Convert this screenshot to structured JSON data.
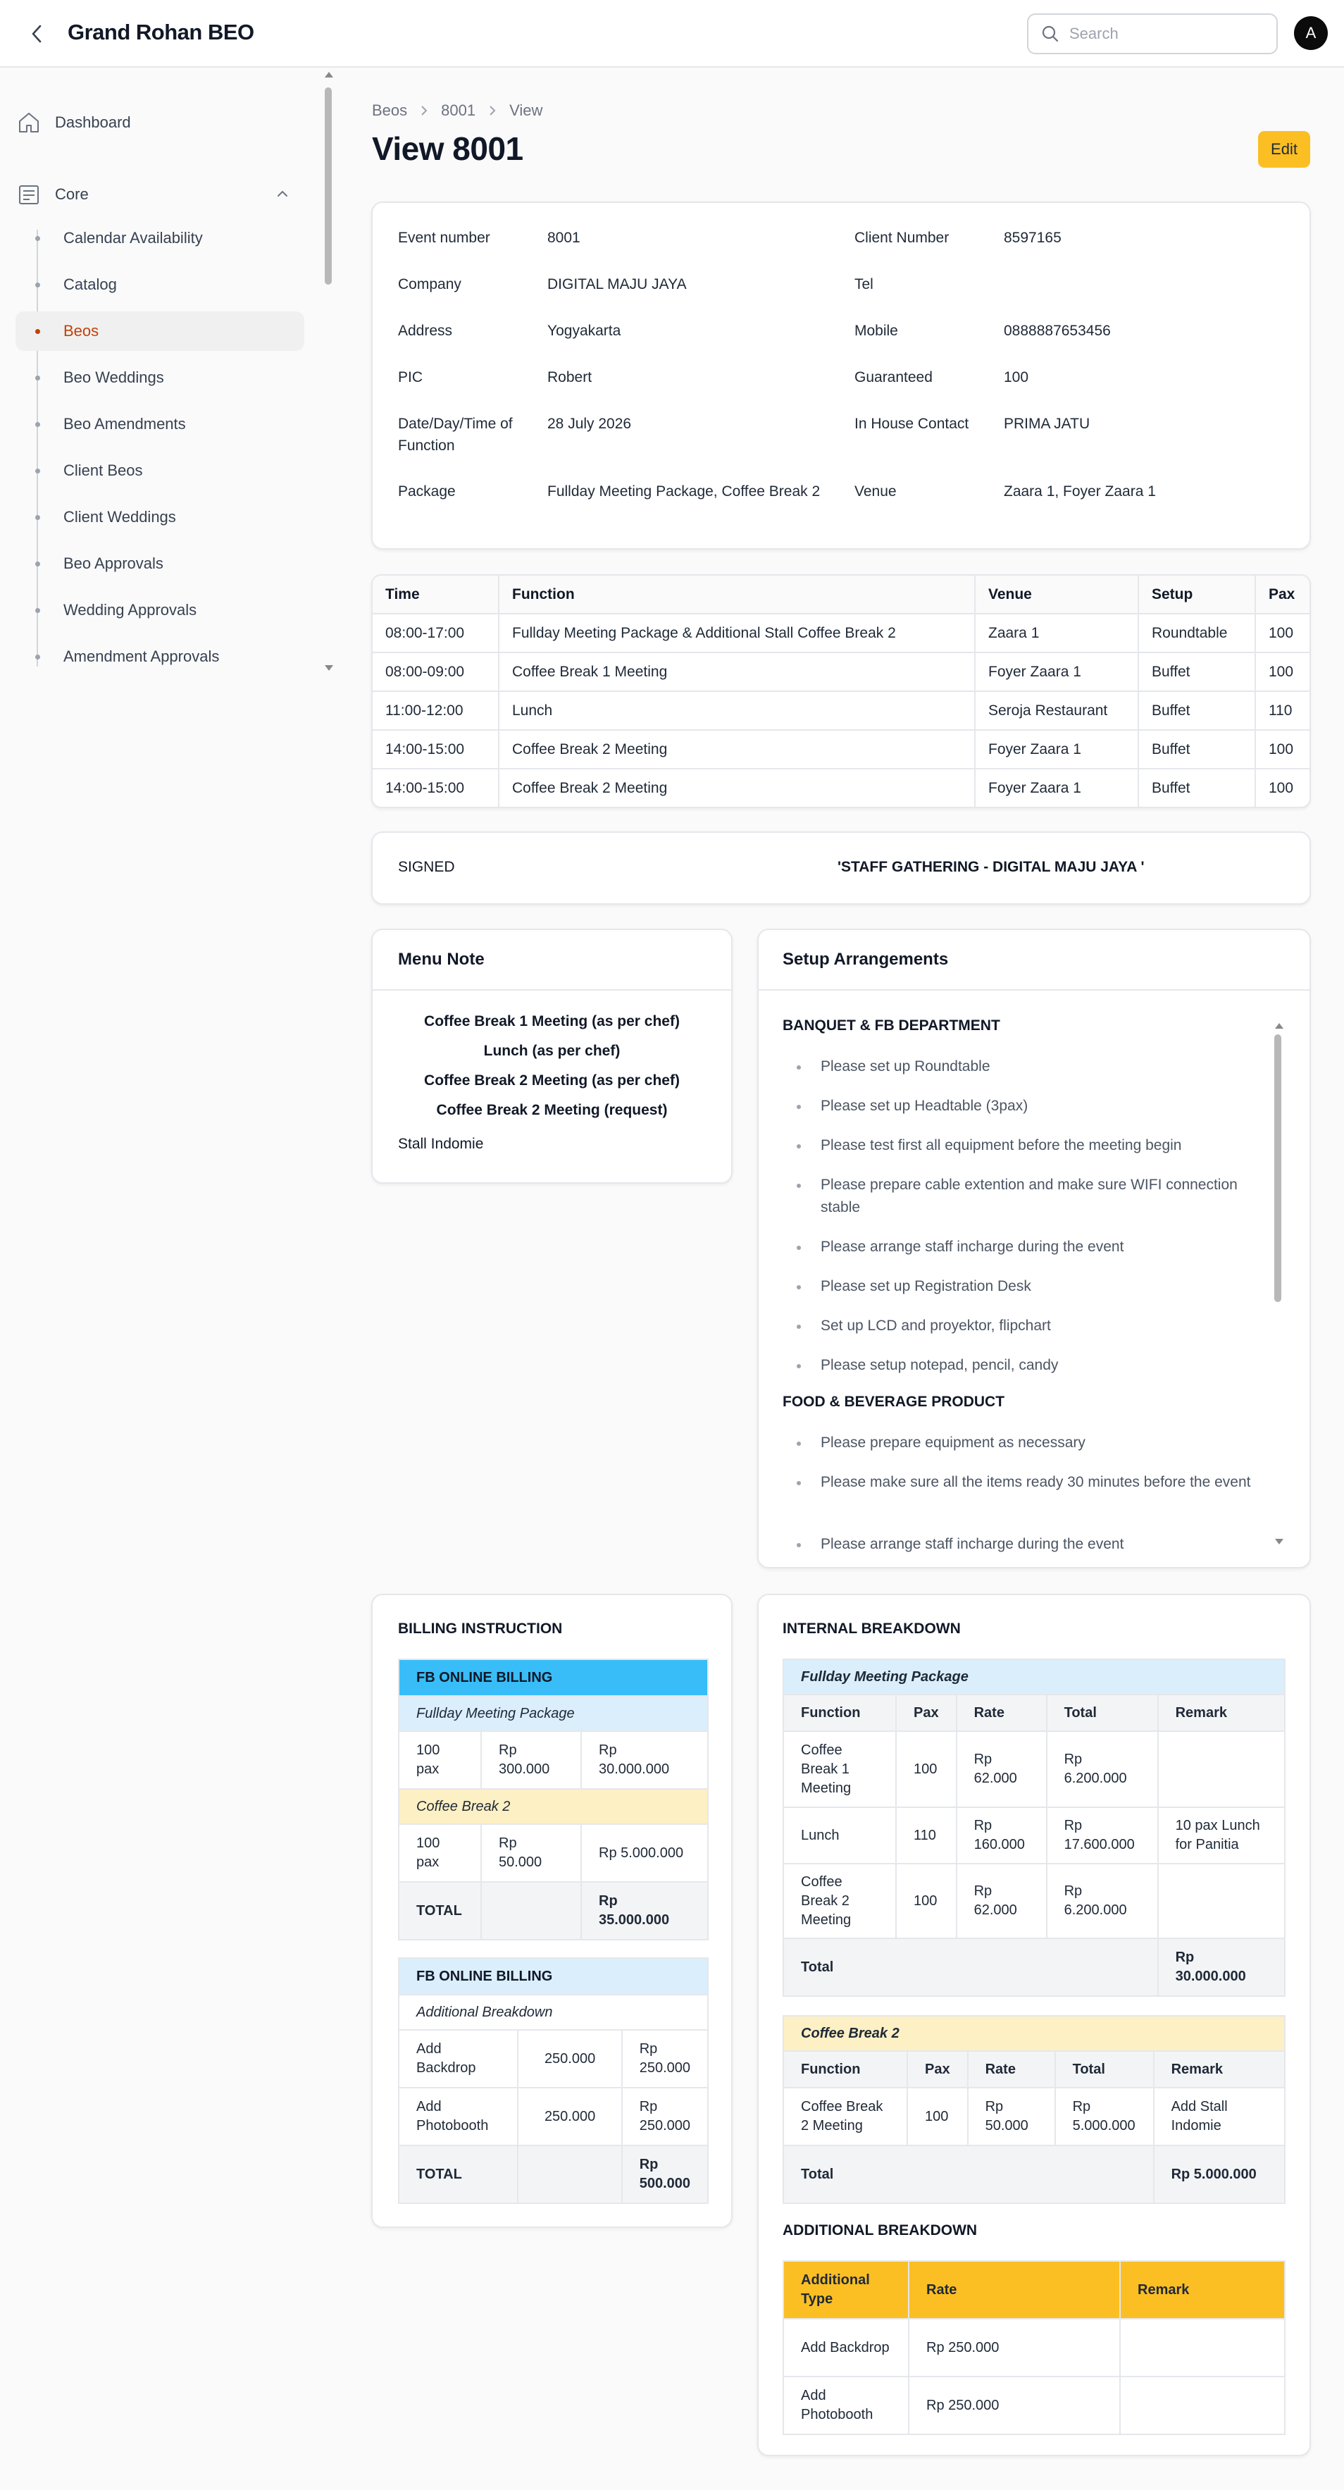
{
  "header": {
    "title": "Grand Rohan BEO",
    "search_placeholder": "Search",
    "avatar_letter": "A"
  },
  "sidebar": {
    "dashboard": "Dashboard",
    "core": "Core",
    "items": [
      {
        "label": "Calendar Availability"
      },
      {
        "label": "Catalog"
      },
      {
        "label": "Beos",
        "active": true
      },
      {
        "label": "Beo Weddings"
      },
      {
        "label": "Beo Amendments"
      },
      {
        "label": "Client Beos"
      },
      {
        "label": "Client Weddings"
      },
      {
        "label": "Beo Approvals"
      },
      {
        "label": "Wedding Approvals"
      },
      {
        "label": "Amendment Approvals"
      }
    ]
  },
  "breadcrumb": [
    "Beos",
    "8001",
    "View"
  ],
  "page_title": "View 8001",
  "edit_label": "Edit",
  "info": {
    "event_number_label": "Event number",
    "event_number": "8001",
    "client_number_label": "Client Number",
    "client_number": "8597165",
    "company_label": "Company",
    "company": "DIGITAL MAJU JAYA",
    "tel_label": "Tel",
    "tel": "",
    "address_label": "Address",
    "address": "Yogyakarta",
    "mobile_label": "Mobile",
    "mobile": "0888887653456",
    "pic_label": "PIC",
    "pic": "Robert",
    "guaranteed_label": "Guaranteed",
    "guaranteed": "100",
    "date_label": "Date/Day/Time of Function",
    "date": "28 July 2026",
    "in_house_label": "In House Contact",
    "in_house": "PRIMA JATU",
    "package_label": "Package",
    "package": "Fullday Meeting Package, Coffee Break 2",
    "venue_label": "Venue",
    "venue": "Zaara 1, Foyer Zaara 1"
  },
  "functions": {
    "headers": [
      "Time",
      "Function",
      "Venue",
      "Setup",
      "Pax"
    ],
    "rows": [
      [
        "08:00-17:00",
        "Fullday Meeting Package & Additional Stall Coffee Break 2",
        "Zaara 1",
        "Roundtable",
        "100"
      ],
      [
        "08:00-09:00",
        "Coffee Break 1 Meeting",
        "Foyer Zaara 1",
        "Buffet",
        "100"
      ],
      [
        "11:00-12:00",
        "Lunch",
        "Seroja Restaurant",
        "Buffet",
        "110"
      ],
      [
        "14:00-15:00",
        "Coffee Break 2 Meeting",
        "Foyer Zaara 1",
        "Buffet",
        "100"
      ],
      [
        "14:00-15:00",
        "Coffee Break 2 Meeting",
        "Foyer Zaara 1",
        "Buffet",
        "100"
      ]
    ]
  },
  "signed": {
    "label": "SIGNED",
    "value": "'STAFF GATHERING - DIGITAL MAJU JAYA '"
  },
  "menu_note": {
    "title": "Menu Note",
    "bold_lines": [
      "Coffee Break 1 Meeting (as per chef)",
      "Lunch (as per chef)",
      "Coffee Break 2 Meeting (as per chef)",
      "Coffee Break 2 Meeting (request)"
    ],
    "extra": "Stall Indomie"
  },
  "setup": {
    "title": "Setup Arrangements",
    "sections": [
      {
        "heading": "BANQUET & FB DEPARTMENT",
        "items": [
          "Please set up Roundtable",
          "Please set up Headtable (3pax)",
          "Please test first all equipment before the meeting begin",
          "Please prepare cable extention and make sure WIFI connection stable",
          "Please arrange staff incharge during the event",
          "Please set up Registration Desk",
          "Set up LCD and proyektor, flipchart",
          "Please setup notepad, pencil, candy"
        ]
      },
      {
        "heading": "FOOD & BEVERAGE PRODUCT",
        "items": [
          "Please prepare equipment as necessary",
          "Please make sure all the items ready 30 minutes before the event",
          "Please arrange staff incharge during the event"
        ]
      }
    ]
  },
  "billing": {
    "title": "BILLING INSTRUCTION",
    "block1": {
      "head": "FB ONLINE BILLING",
      "g1": "Fullday Meeting Package",
      "g1_row": [
        "100 pax",
        "Rp 300.000",
        "Rp 30.000.000"
      ],
      "g2": "Coffee Break 2",
      "g2_row": [
        "100 pax",
        "Rp 50.000",
        "Rp 5.000.000"
      ],
      "total_label": "TOTAL",
      "total": "Rp 35.000.000"
    },
    "block2": {
      "head": "FB ONLINE BILLING",
      "sub": "Additional Breakdown",
      "rows": [
        [
          "Add Backdrop",
          "250.000",
          "Rp 250.000"
        ],
        [
          "Add Photobooth",
          "250.000",
          "Rp 250.000"
        ]
      ],
      "total_label": "TOTAL",
      "total": "Rp 500.000"
    }
  },
  "internal": {
    "title": "INTERNAL BREAKDOWN",
    "headers": [
      "Function",
      "Pax",
      "Rate",
      "Total",
      "Remark"
    ],
    "g1": "Fullday Meeting Package",
    "g1_rows": [
      [
        "Coffee Break 1 Meeting",
        "100",
        "Rp 62.000",
        "Rp 6.200.000",
        ""
      ],
      [
        "Lunch",
        "110",
        "Rp 160.000",
        "Rp 17.600.000",
        "10 pax Lunch for Panitia"
      ],
      [
        "Coffee Break 2 Meeting",
        "100",
        "Rp 62.000",
        "Rp 6.200.000",
        ""
      ]
    ],
    "g1_total_label": "Total",
    "g1_total": "Rp 30.000.000",
    "g2": "Coffee Break 2",
    "g2_rows": [
      [
        "Coffee Break 2 Meeting",
        "100",
        "Rp 50.000",
        "Rp 5.000.000",
        "Add Stall Indomie"
      ]
    ],
    "g2_total_label": "Total",
    "g2_total": "Rp 5.000.000",
    "additional_title": "ADDITIONAL BREAKDOWN",
    "additional_headers": [
      "Additional Type",
      "Rate",
      "Remark"
    ],
    "additional_rows": [
      [
        "Add Backdrop",
        "Rp 250.000",
        ""
      ],
      [
        "Add Photobooth",
        "Rp 250.000",
        ""
      ]
    ]
  },
  "colors": {
    "accent": "#c2410c",
    "edit": "#fbbf24",
    "billing_head": "#38bdf8",
    "light_blue": "#dbeefc",
    "light_yellow": "#fdf0c4",
    "additional_head": "#fbbf24"
  }
}
